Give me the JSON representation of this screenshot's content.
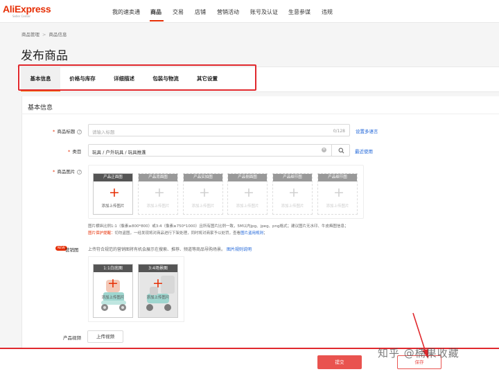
{
  "brand": {
    "name": "AliExpress",
    "tagline": "Seller Center"
  },
  "nav": [
    "我的速卖通",
    "商品",
    "交易",
    "店铺",
    "营销活动",
    "账号及认证",
    "生意参谋",
    "违规"
  ],
  "breadcrumb": [
    "商品管理",
    "商品信息"
  ],
  "page_title": "发布商品",
  "tabs": [
    "基本信息",
    "价格与库存",
    "详细描述",
    "包装与物流",
    "其它设置"
  ],
  "section_title": "基本信息",
  "fields": {
    "title_label": "商品标题",
    "title_placeholder": "请输入标题",
    "title_counter": "0/128",
    "multilang_link": "设置多语言",
    "category_label": "类目",
    "category_value": "玩具 / 户外玩具 / 玩具推蓬",
    "recent_link": "最近使用",
    "images_label": "商品图片"
  },
  "image_slots": [
    {
      "caption": "产品正面图",
      "action": "添加上传图片"
    },
    {
      "caption": "产品背面图",
      "action": "添加上传图片"
    },
    {
      "caption": "产品实拍图",
      "action": "添加上传图片"
    },
    {
      "caption": "产品侧面图",
      "action": "添加上传图片"
    },
    {
      "caption": "产品细节图",
      "action": "添加上传图片"
    },
    {
      "caption": "产品细节图",
      "action": "添加上传图片"
    }
  ],
  "image_note": {
    "line1": "图片横纵比例1:1（像素≥800*800）或3:4（像素≥750*1000）且所有图片比例一致，5M以内jpg、jpeg、png格式；建议图片无水印、牛皮癣图信息；",
    "warn_label": "图片保护提醒：",
    "warn_text": "切勿盗图，一经发现将对商品进行下架处理，同时将对商家予以处罚，查看",
    "warn_link": "图片盗用规则",
    "warn_end": "；"
  },
  "marketing": {
    "badge": "NEW",
    "label": "营销图",
    "desc": "上传符合规范的营销图将有机会展示在搜索、推荐、频道等商品导购场景。",
    "link": "图片规则说明",
    "slots": [
      {
        "caption": "1:1白底图",
        "action": "添加上传图片"
      },
      {
        "caption": "3:4场景图",
        "action": "添加上传图片"
      }
    ]
  },
  "video": {
    "label": "产品视频",
    "button": "上传视频"
  },
  "actions": {
    "submit": "提交",
    "save": "保存"
  },
  "watermark": "知乎 @楠果收藏",
  "colors": {
    "brand": "#e62e04",
    "link": "#1a62d8",
    "annotation": "#e0282d",
    "submit": "#e9534f"
  }
}
